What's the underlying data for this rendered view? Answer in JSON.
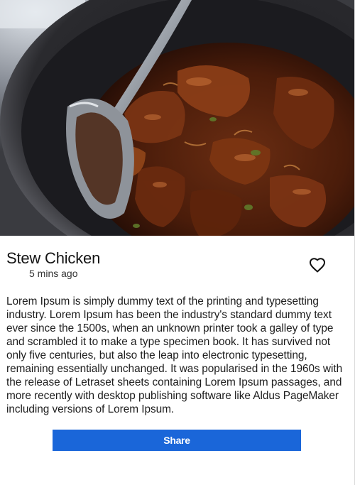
{
  "recipe": {
    "title": "Stew Chicken",
    "time_ago": "5 mins ago",
    "description": "Lorem Ipsum is simply dummy text of the printing and typesetting industry. Lorem Ipsum has been the industry's standard dummy text ever since the 1500s, when an unknown printer took a galley of type and scrambled it to make a type specimen book. It has survived not only five centuries, but also the leap into electronic typesetting, remaining essentially unchanged. It was popularised in the 1960s with the release of Letraset sheets containing Lorem Ipsum passages, and more recently with desktop publishing software like Aldus PageMaker including versions of Lorem Ipsum.",
    "favorite_icon": "heart-outline-icon"
  },
  "actions": {
    "share_label": "Share"
  },
  "colors": {
    "accent": "#1a66d9",
    "button_text": "#ffffff"
  }
}
